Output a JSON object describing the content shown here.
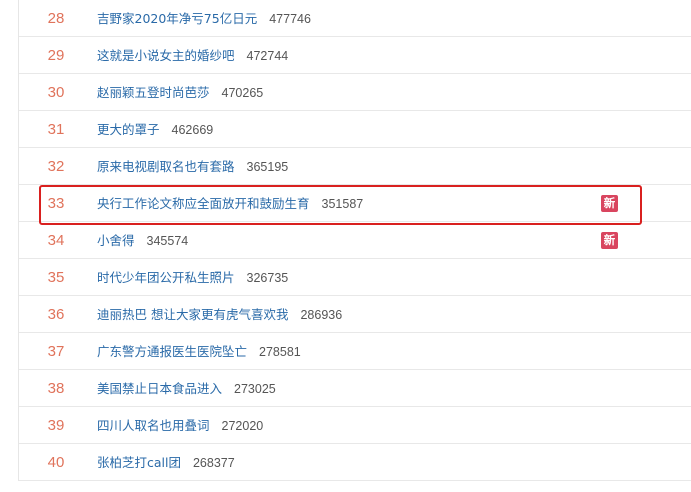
{
  "list": [
    {
      "rank": "28",
      "title": "吉野家2020年净亏75亿日元",
      "count": "477746",
      "badge": ""
    },
    {
      "rank": "29",
      "title": "这就是小说女主的婚纱吧",
      "count": "472744",
      "badge": ""
    },
    {
      "rank": "30",
      "title": "赵丽颖五登时尚芭莎",
      "count": "470265",
      "badge": ""
    },
    {
      "rank": "31",
      "title": "更大的罩子",
      "count": "462669",
      "badge": ""
    },
    {
      "rank": "32",
      "title": "原来电视剧取名也有套路",
      "count": "365195",
      "badge": ""
    },
    {
      "rank": "33",
      "title": "央行工作论文称应全面放开和鼓励生育",
      "count": "351587",
      "badge": "新"
    },
    {
      "rank": "34",
      "title": "小舍得",
      "count": "345574",
      "badge": "新"
    },
    {
      "rank": "35",
      "title": "时代少年团公开私生照片",
      "count": "326735",
      "badge": ""
    },
    {
      "rank": "36",
      "title": "迪丽热巴 想让大家更有虎气喜欢我",
      "count": "286936",
      "badge": ""
    },
    {
      "rank": "37",
      "title": "广东警方通报医生医院坠亡",
      "count": "278581",
      "badge": ""
    },
    {
      "rank": "38",
      "title": "美国禁止日本食品进入",
      "count": "273025",
      "badge": ""
    },
    {
      "rank": "39",
      "title": "四川人取名也用叠词",
      "count": "272020",
      "badge": ""
    },
    {
      "rank": "40",
      "title": "张柏芝打call团",
      "count": "268377",
      "badge": ""
    }
  ],
  "colors": {
    "rank": "#e0735b",
    "title": "#2a6aa8",
    "badge_bg": "#d9455f",
    "highlight": "#d9201f"
  }
}
